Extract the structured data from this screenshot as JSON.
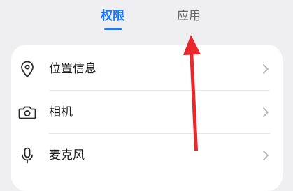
{
  "tabs": {
    "permissions": "权限",
    "apps": "应用"
  },
  "permissions": {
    "items": [
      {
        "label": "位置信息",
        "icon": "location-pin-icon"
      },
      {
        "label": "相机",
        "icon": "camera-icon"
      },
      {
        "label": "麦克风",
        "icon": "microphone-icon"
      }
    ]
  },
  "colors": {
    "accent": "#1677ff",
    "annotation": "#e8282b",
    "background": "#efeff2",
    "card": "#ffffff"
  }
}
